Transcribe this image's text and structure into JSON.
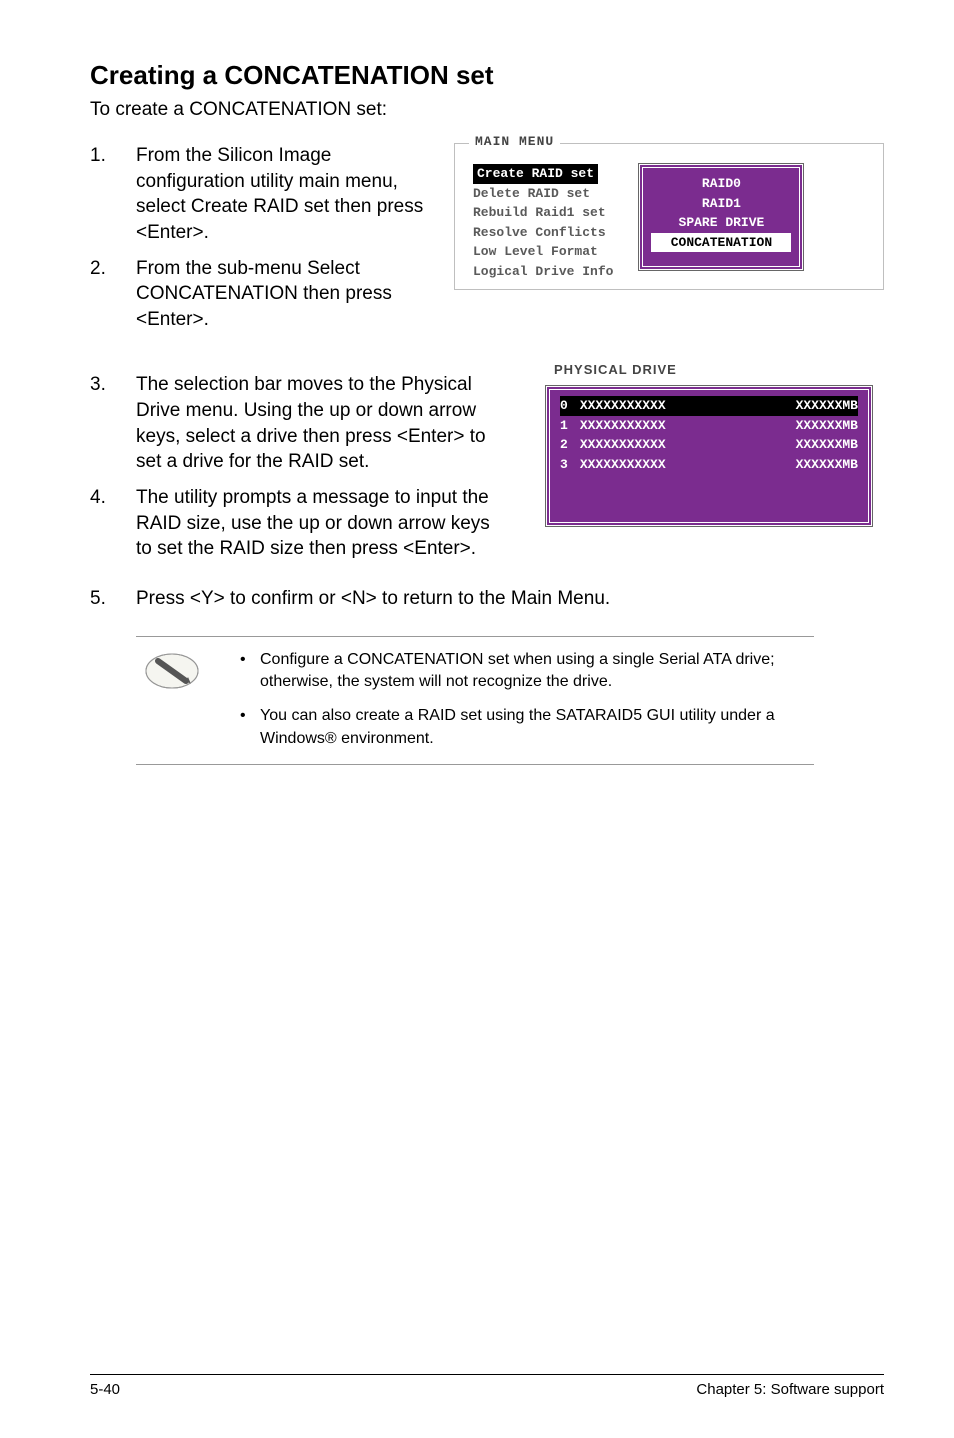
{
  "heading": "Creating a CONCATENATION set",
  "intro": "To create a CONCATENATION set:",
  "steps_block1": [
    {
      "num": "1.",
      "text": "From the Silicon Image configuration utility main menu, select Create RAID set then press <Enter>."
    },
    {
      "num": "2.",
      "text": "From the sub-menu Select CONCATENATION then press <Enter>."
    }
  ],
  "main_menu": {
    "label": "MAIN MENU",
    "items": [
      {
        "text": "Create RAID set",
        "highlight": true
      },
      {
        "text": "Delete RAID set",
        "highlight": false
      },
      {
        "text": "Rebuild Raid1 set",
        "highlight": false
      },
      {
        "text": "Resolve Conflicts",
        "highlight": false
      },
      {
        "text": "Low Level Format",
        "highlight": false
      },
      {
        "text": "Logical Drive Info",
        "highlight": false
      }
    ],
    "raid_options": [
      {
        "text": "RAID0",
        "highlight": false
      },
      {
        "text": "RAID1",
        "highlight": false
      },
      {
        "text": "SPARE DRIVE",
        "highlight": false
      },
      {
        "text": "CONCATENATION",
        "highlight": true
      }
    ]
  },
  "steps_block2": [
    {
      "num": "3.",
      "text": "The selection bar moves to the Physical Drive menu. Using the up or down arrow keys, select a drive then press <Enter> to set a drive for the RAID set."
    },
    {
      "num": "4.",
      "text": "The utility prompts a message to input the RAID size, use the up or down arrow keys to set the RAID size then press <Enter>."
    }
  ],
  "phys_drive": {
    "label": "PHYSICAL DRIVE",
    "rows": [
      {
        "idx": "0",
        "name": "XXXXXXXXXXX",
        "size": "XXXXXXMB",
        "highlight": true
      },
      {
        "idx": "1",
        "name": "XXXXXXXXXXX",
        "size": "XXXXXXMB",
        "highlight": false
      },
      {
        "idx": "2",
        "name": "XXXXXXXXXXX",
        "size": "XXXXXXMB",
        "highlight": false
      },
      {
        "idx": "3",
        "name": "XXXXXXXXXXX",
        "size": "XXXXXXMB",
        "highlight": false
      }
    ]
  },
  "step5": {
    "num": "5.",
    "text": "Press <Y> to confirm or <N> to return to the Main Menu."
  },
  "notes": [
    "Configure a CONCATENATION set when using a single Serial ATA drive; otherwise, the system will not recognize the drive.",
    "You can also create a RAID set using the SATARAID5 GUI utility under a Windows® environment."
  ],
  "footer": {
    "left": "5-40",
    "right": "Chapter 5: Software support"
  }
}
